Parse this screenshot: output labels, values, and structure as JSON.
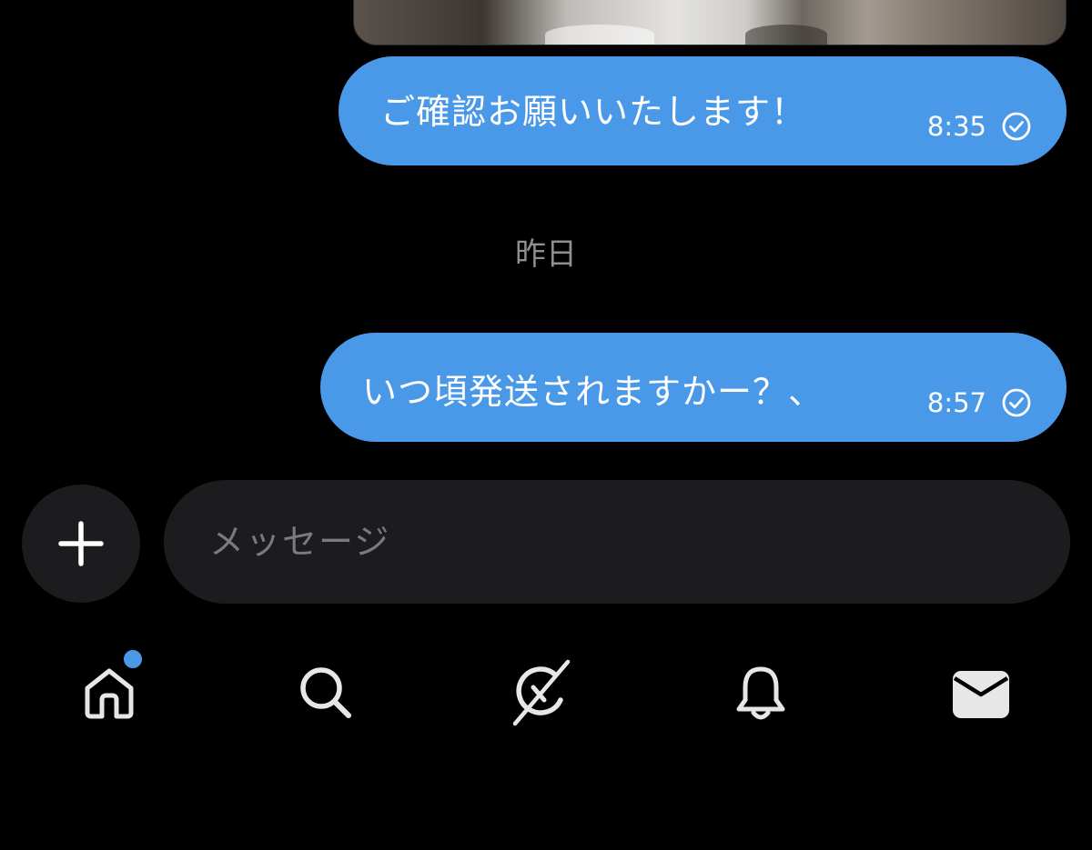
{
  "colors": {
    "background": "#000000",
    "bubble": "#4a99e9",
    "input_bg": "#1c1c1e",
    "muted_text": "#8e8e93",
    "badge": "#4a99e9",
    "icon": "#e7e7e7"
  },
  "messages": [
    {
      "text": "ご確認お願いいたします！",
      "time": "8:35",
      "status_icon": "check-circle-icon"
    },
    {
      "text": "いつ頃発送されますかー？、",
      "time": "8:57",
      "status_icon": "check-circle-icon"
    }
  ],
  "date_separator": "昨日",
  "composer": {
    "placeholder": "メッセージ",
    "value": "",
    "add_icon": "plus-icon"
  },
  "tab_bar": {
    "items": [
      {
        "icon": "home-icon",
        "has_badge": true
      },
      {
        "icon": "search-icon"
      },
      {
        "icon": "grok-icon"
      },
      {
        "icon": "bell-icon"
      },
      {
        "icon": "mail-icon"
      }
    ]
  }
}
